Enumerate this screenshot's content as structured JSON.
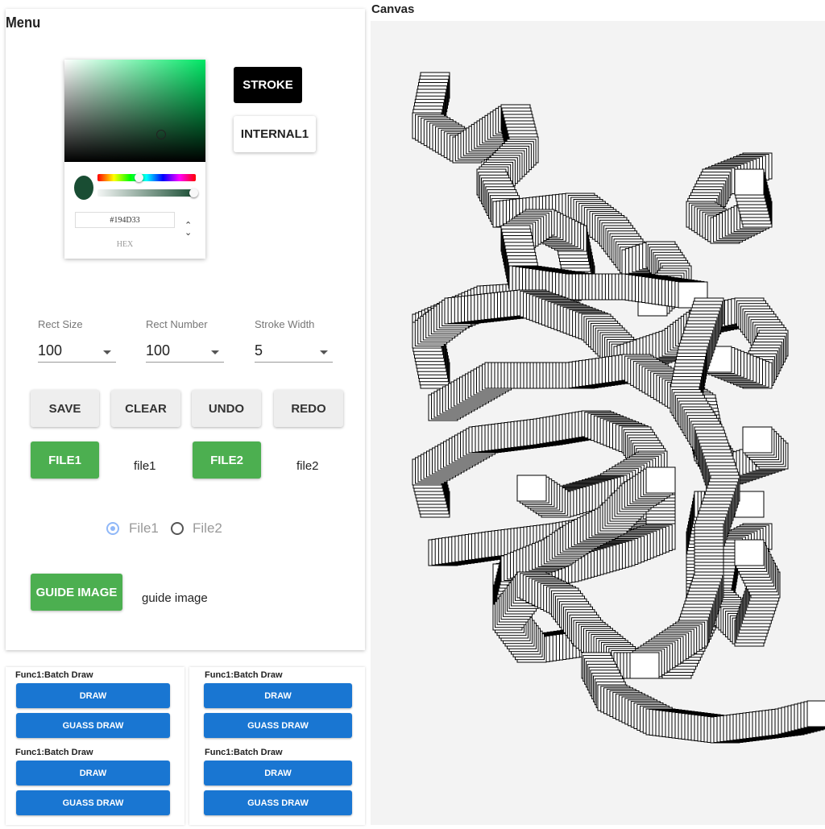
{
  "menu": {
    "title": "Menu",
    "color_picker": {
      "hex_value": "#194D33",
      "hex_label": "HEX",
      "color": "#194D33",
      "toggle_icon": "chevron-up-down-icon"
    },
    "stroke_button": "STROKE",
    "internal_button": "INTERNAL1",
    "selects": [
      {
        "label": "Rect Size",
        "value": "100"
      },
      {
        "label": "Rect Number",
        "value": "100"
      },
      {
        "label": "Stroke Width",
        "value": "5"
      }
    ],
    "actions": {
      "save": "SAVE",
      "clear": "CLEAR",
      "undo": "UNDO",
      "redo": "REDO"
    },
    "file1_button": "FILE1",
    "file1_label": "file1",
    "file2_button": "FILE2",
    "file2_label": "file2",
    "radio": {
      "options": [
        "File1",
        "File2"
      ],
      "selected": "File1",
      "accent_color": "#90b8f8"
    },
    "guide_button": "GUIDE IMAGE",
    "guide_label": "guide image"
  },
  "func_panels": [
    {
      "sections": [
        {
          "title": "Func1:Batch Draw",
          "draw": "DRAW",
          "gauss": "GUASS DRAW"
        },
        {
          "title": "Func1:Batch Draw",
          "draw": "DRAW",
          "gauss": "GUASS DRAW"
        }
      ]
    },
    {
      "sections": [
        {
          "title": "Func1:Batch Draw",
          "draw": "DRAW",
          "gauss": "GUASS DRAW"
        },
        {
          "title": "Func1:Batch Draw",
          "draw": "DRAW",
          "gauss": "GUASS DRAW"
        }
      ]
    }
  ],
  "canvas": {
    "title": "Canvas",
    "background": "#f3f3f3",
    "drawing": "overlapping outlined rectangles forming looping ribbon strokes"
  },
  "colors": {
    "green": "#4caf50",
    "blue": "#1976d2",
    "black": "#000000"
  }
}
